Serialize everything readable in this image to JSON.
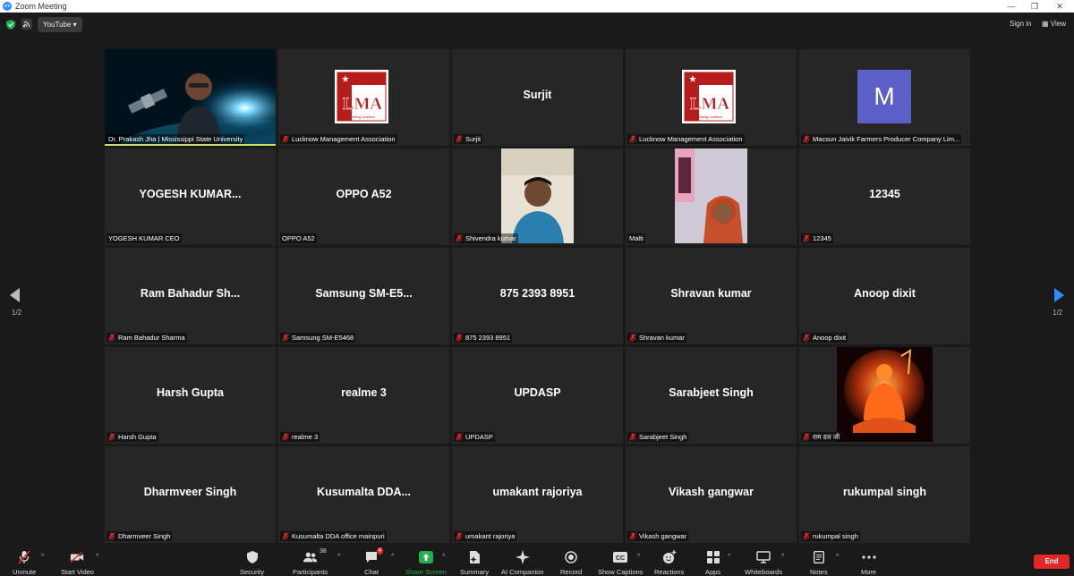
{
  "window": {
    "title": "Zoom Meeting",
    "app_icon": "zm"
  },
  "topbar": {
    "youtube_label": "YouTube",
    "signin_label": "Sign in",
    "view_label": "View"
  },
  "pager": {
    "left": "1/2",
    "right": "1/2"
  },
  "tiles": [
    {
      "big": "",
      "label": "Dr. Prakash Jha | Mississippi State University",
      "muted": false,
      "kind": "video-prakash"
    },
    {
      "big": "",
      "label": "Lucknow Management Association",
      "muted": true,
      "kind": "lma",
      "logo_text": "LMA",
      "logo_sub": "Building Leaders"
    },
    {
      "big": "Surjit",
      "label": "Surjit",
      "muted": true,
      "kind": "name"
    },
    {
      "big": "",
      "label": "Lucknow Management Association",
      "muted": true,
      "kind": "lma",
      "logo_text": "LMA",
      "logo_sub": "Building Leaders"
    },
    {
      "big": "",
      "label": "Macsun Jaivik Farmers Producer Company Lim...",
      "muted": true,
      "kind": "avatar",
      "avatar_letter": "M"
    },
    {
      "big": "YOGESH  KUMAR...",
      "label": "YOGESH KUMAR CEO",
      "muted": false,
      "kind": "name"
    },
    {
      "big": "OPPO A52",
      "label": "OPPO A52",
      "muted": false,
      "kind": "name"
    },
    {
      "big": "",
      "label": "Shivendra kumar",
      "muted": true,
      "kind": "video-shivendra"
    },
    {
      "big": "",
      "label": "Malti",
      "muted": false,
      "kind": "video-malti"
    },
    {
      "big": "12345",
      "label": "12345",
      "muted": true,
      "kind": "name"
    },
    {
      "big": "Ram  Bahadur  Sh...",
      "label": "Ram Bahadur Sharma",
      "muted": true,
      "kind": "name"
    },
    {
      "big": "Samsung  SM-E5...",
      "label": "Samsung SM-E5468",
      "muted": true,
      "kind": "name"
    },
    {
      "big": "875 2393 8951",
      "label": "875 2393 8951",
      "muted": true,
      "kind": "name"
    },
    {
      "big": "Shravan kumar",
      "label": "Shravan kumar",
      "muted": true,
      "kind": "name"
    },
    {
      "big": "Anoop dixit",
      "label": "Anoop dixit",
      "muted": true,
      "kind": "name"
    },
    {
      "big": "Harsh Gupta",
      "label": "Harsh Gupta",
      "muted": true,
      "kind": "name"
    },
    {
      "big": "realme 3",
      "label": "realme 3",
      "muted": true,
      "kind": "name"
    },
    {
      "big": "UPDASP",
      "label": "UPDASP",
      "muted": true,
      "kind": "name"
    },
    {
      "big": "Sarabjeet Singh",
      "label": "Sarabjeet Singh",
      "muted": true,
      "kind": "name"
    },
    {
      "big": "",
      "label": "राम दत्त जी",
      "muted": true,
      "kind": "image-hanuman"
    },
    {
      "big": "Dharmveer Singh",
      "label": "Dharmveer Singh",
      "muted": true,
      "kind": "name"
    },
    {
      "big": "Kusumalta  DDA...",
      "label": "Kusumalta DDA office mainpuri",
      "muted": true,
      "kind": "name"
    },
    {
      "big": "umakant rajoriya",
      "label": "umakant rajoriya",
      "muted": true,
      "kind": "name"
    },
    {
      "big": "Vikash gangwar",
      "label": "Vikash gangwar",
      "muted": true,
      "kind": "name"
    },
    {
      "big": "rukumpal singh",
      "label": "rukumpal singh",
      "muted": true,
      "kind": "name"
    }
  ],
  "toolbar": {
    "unmute": "Unmute",
    "start_video": "Start Video",
    "security": "Security",
    "participants": "Participants",
    "participants_count": "38",
    "chat": "Chat",
    "chat_badge": "4",
    "share_screen": "Share Screen",
    "summary": "Summary",
    "ai_companion": "AI Companion",
    "record": "Record",
    "show_captions": "Show Captions",
    "reactions": "Reactions",
    "apps": "Apps",
    "whiteboards": "Whiteboards",
    "notes": "Notes",
    "more": "More",
    "end": "End"
  },
  "colors": {
    "accent": "#2d8cff",
    "active_speaker": "#c8e36a",
    "end": "#e02828",
    "share": "#22b14c"
  }
}
